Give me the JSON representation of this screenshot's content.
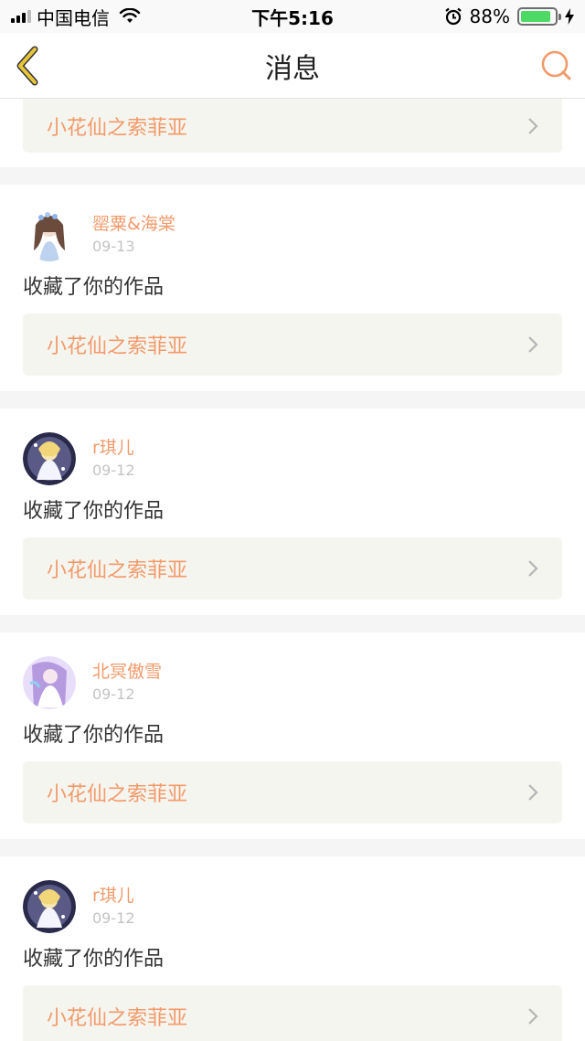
{
  "status_bar": {
    "carrier": "中国电信",
    "time": "下午5:16",
    "battery_percent": "88%",
    "battery_level": 0.88
  },
  "nav": {
    "title": "消息",
    "back_icon": "chevron-left-icon",
    "search_icon": "search-icon"
  },
  "colors": {
    "accent": "#f29a6a",
    "back_accent": "#e8c43a",
    "card_bg": "#f5f5ef",
    "battery_green": "#4cd964"
  },
  "partial_card": {
    "work_title": "小花仙之索菲亚"
  },
  "messages": [
    {
      "user": "罂粟&海棠",
      "date": "09-13",
      "action": "收藏了你的作品",
      "work_title": "小花仙之索菲亚"
    },
    {
      "user": "r琪儿",
      "date": "09-12",
      "action": "收藏了你的作品",
      "work_title": "小花仙之索菲亚"
    },
    {
      "user": "北冥傲雪",
      "date": "09-12",
      "action": "收藏了你的作品",
      "work_title": "小花仙之索菲亚"
    },
    {
      "user": "r琪儿",
      "date": "09-12",
      "action": "收藏了你的作品",
      "work_title": "小花仙之索菲亚"
    }
  ]
}
